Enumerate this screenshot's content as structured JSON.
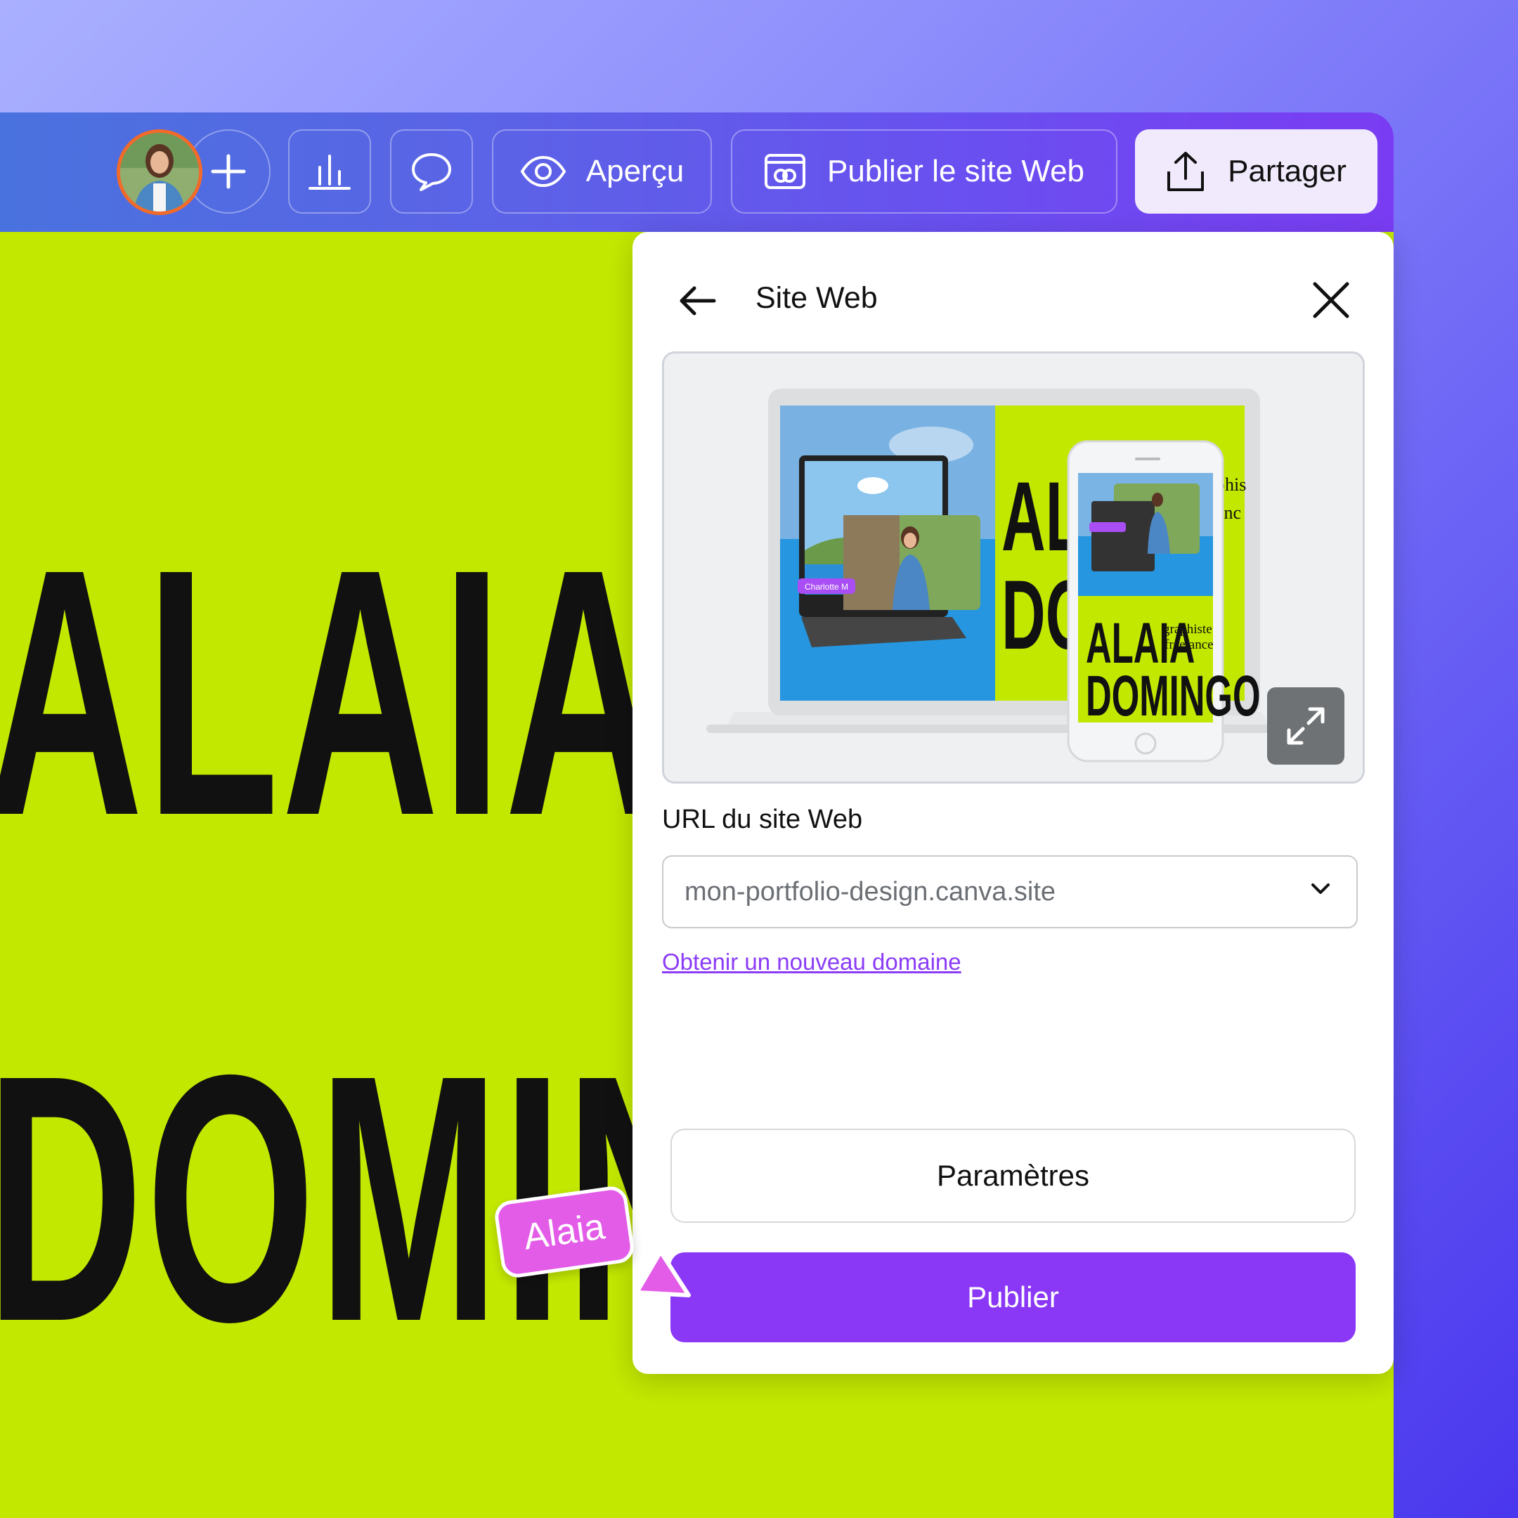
{
  "toolbar": {
    "preview_label": "Aperçu",
    "publish_site_label": "Publier le site Web",
    "share_label": "Partager"
  },
  "canvas": {
    "line1": "ALAIA",
    "line2": "DOMINGO"
  },
  "panel": {
    "title": "Site Web",
    "preview": {
      "collaborator_tag": "Charlotte M",
      "phone_name_line1": "ALAIA",
      "phone_name_line2": "DOMINGO",
      "phone_role_line1": "graphiste",
      "phone_role_line2": "freelance",
      "desktop_name_line1": "AL",
      "desktop_name_line2": "DO",
      "desktop_role_partial_1": "phis",
      "desktop_role_partial_2": "anc"
    },
    "url_label": "URL du site Web",
    "url_value": "mon-portfolio-design.canva.site",
    "new_domain_link": "Obtenir un nouveau domaine",
    "settings_label": "Paramètres",
    "publish_label": "Publier"
  },
  "cursor": {
    "name": "Alaia",
    "color": "#e35ce8"
  },
  "colors": {
    "canvas_background": "#c3e800",
    "accent_purple": "#8a38f6",
    "avatar_ring": "#f26a2a"
  }
}
